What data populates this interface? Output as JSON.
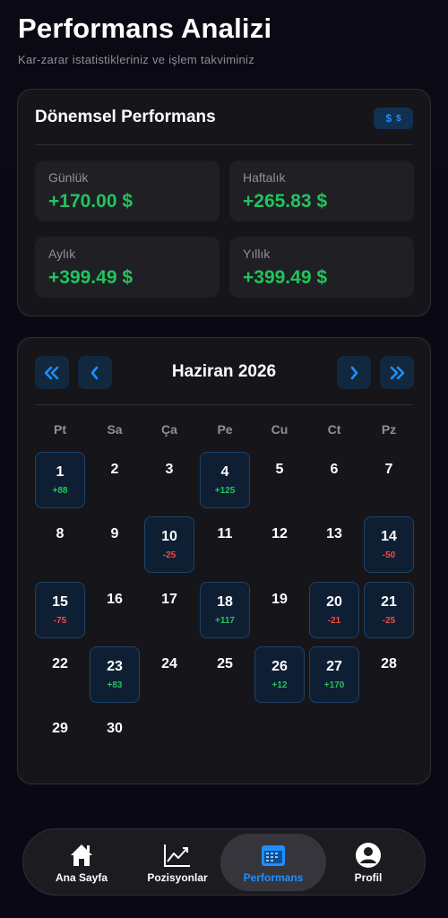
{
  "header": {
    "title": "Performans Analizi",
    "subtitle": "Kar-zarar istatistikleriniz ve işlem takviminiz"
  },
  "performance": {
    "title": "Dönemsel Performans",
    "currency_badge": [
      "$",
      "$"
    ],
    "stats": [
      {
        "label": "Günlük",
        "value": "+170.00 $"
      },
      {
        "label": "Haftalık",
        "value": "+265.83 $"
      },
      {
        "label": "Aylık",
        "value": "+399.49 $"
      },
      {
        "label": "Yıllık",
        "value": "+399.49 $"
      }
    ]
  },
  "calendar": {
    "month": "Haziran 2026",
    "weekdays": [
      "Pt",
      "Sa",
      "Ça",
      "Pe",
      "Cu",
      "Ct",
      "Pz"
    ],
    "days": [
      {
        "day": "1",
        "pnl": "+88"
      },
      {
        "day": "2",
        "pnl": ""
      },
      {
        "day": "3",
        "pnl": ""
      },
      {
        "day": "4",
        "pnl": "+125"
      },
      {
        "day": "5",
        "pnl": ""
      },
      {
        "day": "6",
        "pnl": ""
      },
      {
        "day": "7",
        "pnl": ""
      },
      {
        "day": "8",
        "pnl": ""
      },
      {
        "day": "9",
        "pnl": ""
      },
      {
        "day": "10",
        "pnl": "-25"
      },
      {
        "day": "11",
        "pnl": ""
      },
      {
        "day": "12",
        "pnl": ""
      },
      {
        "day": "13",
        "pnl": ""
      },
      {
        "day": "14",
        "pnl": "-50"
      },
      {
        "day": "15",
        "pnl": "-75"
      },
      {
        "day": "16",
        "pnl": ""
      },
      {
        "day": "17",
        "pnl": ""
      },
      {
        "day": "18",
        "pnl": "+117"
      },
      {
        "day": "19",
        "pnl": ""
      },
      {
        "day": "20",
        "pnl": "-21"
      },
      {
        "day": "21",
        "pnl": "-25"
      },
      {
        "day": "22",
        "pnl": ""
      },
      {
        "day": "23",
        "pnl": "+83"
      },
      {
        "day": "24",
        "pnl": ""
      },
      {
        "day": "25",
        "pnl": ""
      },
      {
        "day": "26",
        "pnl": "+12"
      },
      {
        "day": "27",
        "pnl": "+170"
      },
      {
        "day": "28",
        "pnl": ""
      },
      {
        "day": "29",
        "pnl": ""
      },
      {
        "day": "30",
        "pnl": ""
      }
    ]
  },
  "bottom_nav": [
    {
      "label": "Ana Sayfa",
      "icon": "home-icon",
      "active": false
    },
    {
      "label": "Pozisyonlar",
      "icon": "chart-icon",
      "active": false
    },
    {
      "label": "Performans",
      "icon": "calendar-icon",
      "active": true
    },
    {
      "label": "Profil",
      "icon": "profile-icon",
      "active": false
    }
  ],
  "colors": {
    "accent": "#1e8fff",
    "positive": "#21c45d",
    "negative": "#f24a4a"
  }
}
